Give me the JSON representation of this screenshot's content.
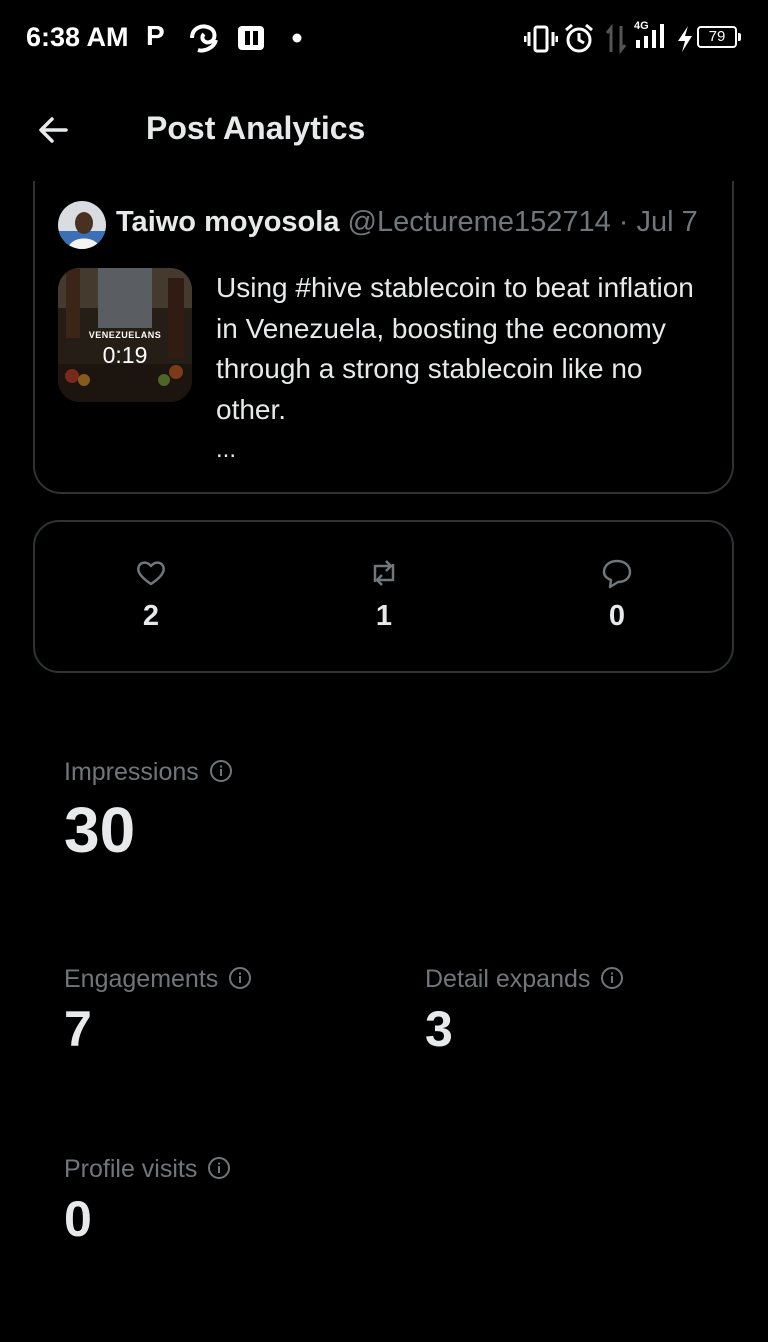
{
  "status_bar": {
    "time": "6:38 AM",
    "app_letter": "P",
    "network": "4G",
    "battery": "79"
  },
  "header": {
    "title": "Post Analytics"
  },
  "post": {
    "author_name": "Taiwo moyosola",
    "handle": "@Lectureme152714",
    "date_sep": " · ",
    "date": "Jul 7",
    "video_caption": "VENEZUELANS",
    "video_duration": "0:19",
    "text": "Using #hive stablecoin to beat inflation in Venezuela, boosting the economy through a strong stablecoin like no other.",
    "more": "..."
  },
  "engagement": {
    "likes": "2",
    "reposts": "1",
    "replies": "0"
  },
  "metrics": {
    "impressions": {
      "label": "Impressions",
      "value": "30"
    },
    "engagements": {
      "label": "Engagements",
      "value": "7"
    },
    "detail_expands": {
      "label": "Detail expands",
      "value": "3"
    },
    "profile_visits": {
      "label": "Profile visits",
      "value": "0"
    }
  },
  "icons": {
    "back": "arrow-left-icon",
    "like": "heart-icon",
    "repost": "repost-icon",
    "reply": "reply-bubble-icon",
    "info": "info-icon"
  },
  "colors": {
    "background": "#000000",
    "text": "#e7e9ea",
    "secondary": "#71767b",
    "border": "#2f3336"
  }
}
